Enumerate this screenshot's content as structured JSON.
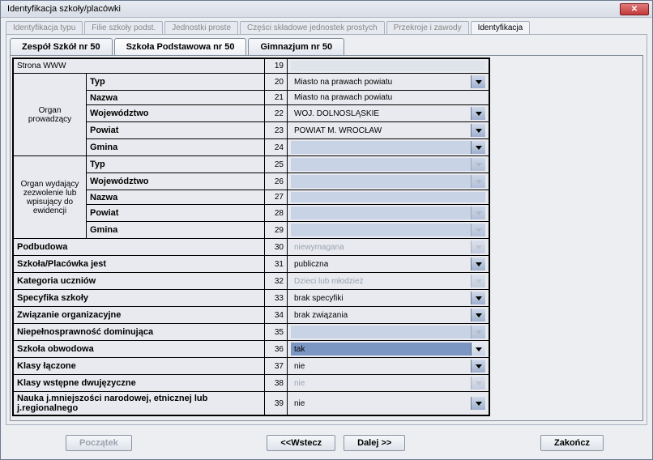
{
  "window": {
    "title": "Identyfikacja szkoły/placówki"
  },
  "outerTabs": {
    "t0": "Identyfikacja typu",
    "t1": "Filie szkoły podst.",
    "t2": "Jednostki proste",
    "t3": "Części składowe jednostek prostych",
    "t4": "Przekroje i zawody",
    "t5": "Identyfikacja"
  },
  "subTabs": {
    "s0": "Zespół Szkół nr 50",
    "s1": "Szkoła Podstawowa nr 50",
    "s2": "Gimnazjum nr 50"
  },
  "groups": {
    "organProwadzacy": "Organ prowadzący",
    "organWydajacy": "Organ wydający zezwolenie lub wpisujący do ewidencji"
  },
  "rows": {
    "r19": {
      "n": "19",
      "label": "Strona WWW",
      "value": ""
    },
    "r20": {
      "n": "20",
      "label": "Typ",
      "value": "Miasto na prawach powiatu"
    },
    "r21": {
      "n": "21",
      "label": "Nazwa",
      "value": "Miasto na prawach powiatu"
    },
    "r22": {
      "n": "22",
      "label": "Województwo",
      "value": "WOJ. DOLNOŚLĄSKIE"
    },
    "r23": {
      "n": "23",
      "label": "Powiat",
      "value": "POWIAT M. WROCŁAW"
    },
    "r24": {
      "n": "24",
      "label": "Gmina",
      "value": ""
    },
    "r25": {
      "n": "25",
      "label": "Typ",
      "value": ""
    },
    "r26": {
      "n": "26",
      "label": "Województwo",
      "value": ""
    },
    "r27": {
      "n": "27",
      "label": "Nazwa",
      "value": ""
    },
    "r28": {
      "n": "28",
      "label": "Powiat",
      "value": ""
    },
    "r29": {
      "n": "29",
      "label": "Gmina",
      "value": ""
    },
    "r30": {
      "n": "30",
      "label": "Podbudowa",
      "value": "niewymagana"
    },
    "r31": {
      "n": "31",
      "label": "Szkoła/Placówka jest",
      "value": "publiczna"
    },
    "r32": {
      "n": "32",
      "label": "Kategoria uczniów",
      "value": "Dzieci lub młodzież"
    },
    "r33": {
      "n": "33",
      "label": "Specyfika szkoły",
      "value": "brak specyfiki"
    },
    "r34": {
      "n": "34",
      "label": "Związanie organizacyjne",
      "value": "brak związania"
    },
    "r35": {
      "n": "35",
      "label": "Niepełnosprawność dominująca",
      "value": ""
    },
    "r36": {
      "n": "36",
      "label": "Szkoła obwodowa",
      "value": "tak"
    },
    "r37": {
      "n": "37",
      "label": "Klasy łączone",
      "value": "nie"
    },
    "r38": {
      "n": "38",
      "label": "Klasy wstępne dwujęzyczne",
      "value": "nie"
    },
    "r39": {
      "n": "39",
      "label": "Nauka j.mniejszości narodowej, etnicznej lub j.regionalnego",
      "value": "nie"
    }
  },
  "footer": {
    "begin": "Początek",
    "back": "<<Wstecz",
    "next": "Dalej >>",
    "end": "Zakończ"
  }
}
